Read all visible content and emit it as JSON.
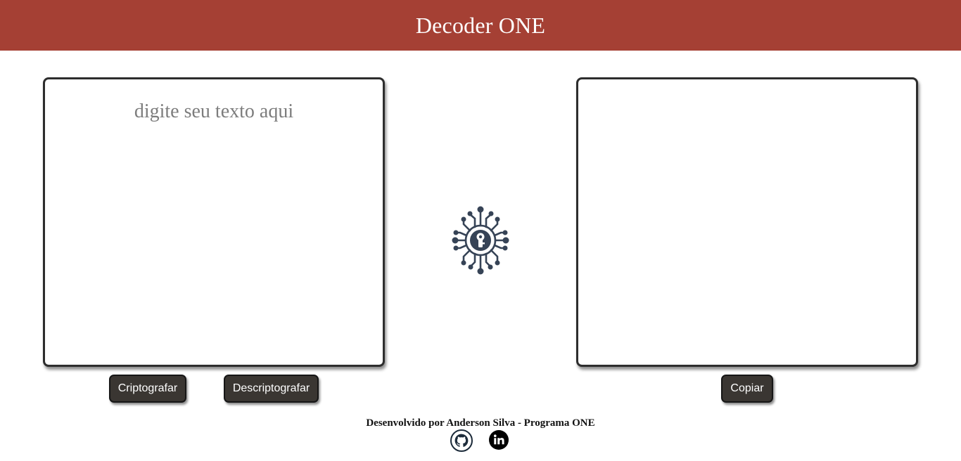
{
  "header": {
    "title": "Decoder ONE"
  },
  "input_panel": {
    "placeholder": "digite seu texto aqui",
    "value": ""
  },
  "output_panel": {
    "value": ""
  },
  "buttons": {
    "encrypt_label": "Criptografar",
    "decrypt_label": "Descriptografar",
    "copy_label": "Copiar"
  },
  "logo": {
    "icon": "circuit-key-icon"
  },
  "footer": {
    "credit": "Desenvolvido por Anderson Silva - Programa ONE",
    "links": [
      {
        "icon": "github-icon"
      },
      {
        "icon": "linkedin-icon"
      }
    ]
  },
  "colors": {
    "brand": "#a54034",
    "button": "#3a3632",
    "logo": "#364356"
  }
}
